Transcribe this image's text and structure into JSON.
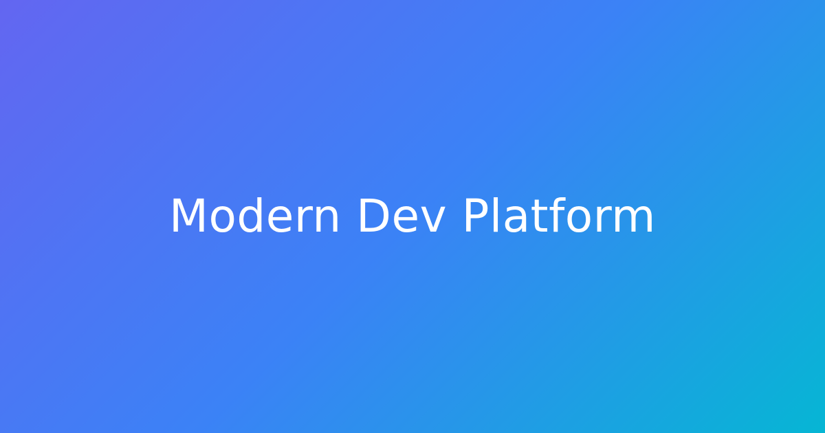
{
  "hero": {
    "title": "Modern Dev Platform",
    "gradient_start": "#6366f1",
    "gradient_mid": "#3b82f6",
    "gradient_end": "#06b6d4",
    "text_color": "#ffffff"
  }
}
